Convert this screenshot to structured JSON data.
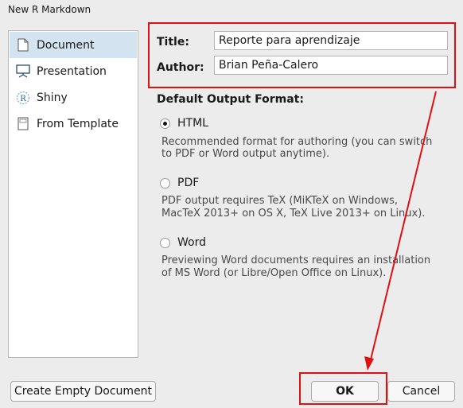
{
  "window": {
    "title": "New R Markdown"
  },
  "sidebar": {
    "items": [
      {
        "label": "Document",
        "icon": "document-icon",
        "active": true
      },
      {
        "label": "Presentation",
        "icon": "presentation-icon",
        "active": false
      },
      {
        "label": "Shiny",
        "icon": "shiny-icon",
        "active": false
      },
      {
        "label": "From Template",
        "icon": "template-icon",
        "active": false
      }
    ]
  },
  "form": {
    "title_label": "Title:",
    "title_value": "Reporte para aprendizaje",
    "author_label": "Author:",
    "author_value": "Brian Peña-Calero"
  },
  "output": {
    "heading": "Default Output Format:",
    "options": [
      {
        "label": "HTML",
        "selected": true,
        "desc1": "Recommended format for authoring (you can switch",
        "desc2": "to PDF or Word output anytime)."
      },
      {
        "label": "PDF",
        "selected": false,
        "desc1": "PDF output requires TeX (MiKTeX on Windows,",
        "desc2": "MacTeX 2013+ on OS X, TeX Live 2013+ on Linux)."
      },
      {
        "label": "Word",
        "selected": false,
        "desc1": "Previewing Word documents requires an installation",
        "desc2": "of MS Word (or Libre/Open Office on Linux)."
      }
    ]
  },
  "buttons": {
    "empty_doc": "Create Empty Document",
    "ok": "OK",
    "cancel": "Cancel"
  },
  "colors": {
    "annotation": "#e01010",
    "selected_row": "#d4e3f0"
  }
}
